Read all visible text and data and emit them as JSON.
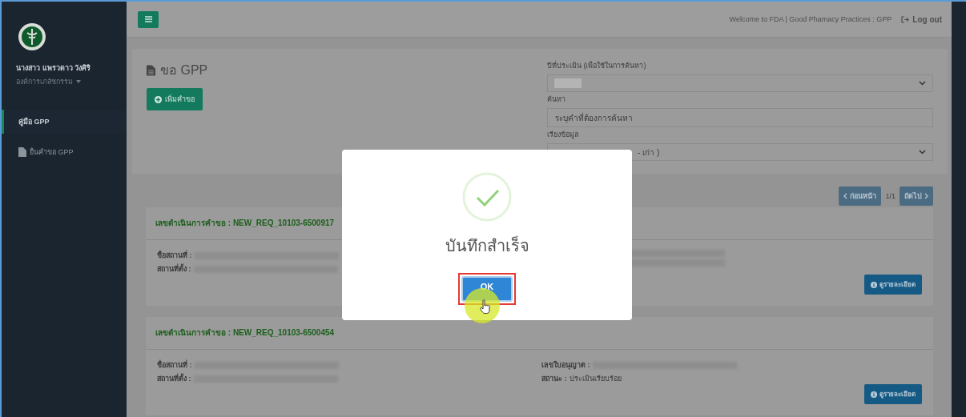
{
  "sidebar": {
    "user_name": "นางสาว แพรวดาว วังศิริ",
    "organization": "องค์การเภสัชกรรม",
    "items": [
      {
        "label": "คู่มือ GPP",
        "selected": true,
        "kind": "plain"
      },
      {
        "label": "ยื่นคำขอ GPP",
        "selected": false,
        "kind": "document"
      }
    ]
  },
  "header": {
    "welcome": "Welcome to FDA | Good Phamacy Practices : GPP",
    "logout": "Log out"
  },
  "panel": {
    "title": "ขอ GPP",
    "add_button": "เพิ่มคำขอ",
    "year_label": "ปีที่ประเมิน (เพื่อใช้ในการค้นหา)",
    "search_label": "ค้นหา",
    "search_placeholder": "ระบุคำที่ต้องการค้นหา",
    "sort_label": "เรียงข้อมูล",
    "sort_value": "- เก่า )"
  },
  "pagination": {
    "prev": "ก่อนหน้า",
    "page": "1/1",
    "next": "ถัดไป"
  },
  "cards": [
    {
      "title": "เลขดำเนินการคำขอ : NEW_REQ_10103-6500917",
      "left": [
        {
          "label": "ชื่อสถานที่ :",
          "value_hidden": true
        },
        {
          "label": "สถานที่ตั้ง :",
          "value_hidden": true
        }
      ],
      "right": [
        {
          "value_hidden": true
        },
        {
          "value_hidden": true
        }
      ],
      "detail_button": "ดูรายละเอียด"
    },
    {
      "title": "เลขดำเนินการคำขอ : NEW_REQ_10103-6500454",
      "left": [
        {
          "label": "ชื่อสถานที่ :",
          "value_hidden": true
        },
        {
          "label": "สถานที่ตั้ง :",
          "value_hidden": true
        }
      ],
      "right": [
        {
          "label": "เลขใบอนุญาต :",
          "value_hidden": true
        },
        {
          "label": "สถานะ :",
          "value": "ประเมินเรียบร้อย",
          "value_hidden": false
        }
      ],
      "detail_button": "ดูรายละเอียด"
    }
  ],
  "dialog": {
    "title": "บันทึกสำเร็จ",
    "ok_button": "OK"
  }
}
